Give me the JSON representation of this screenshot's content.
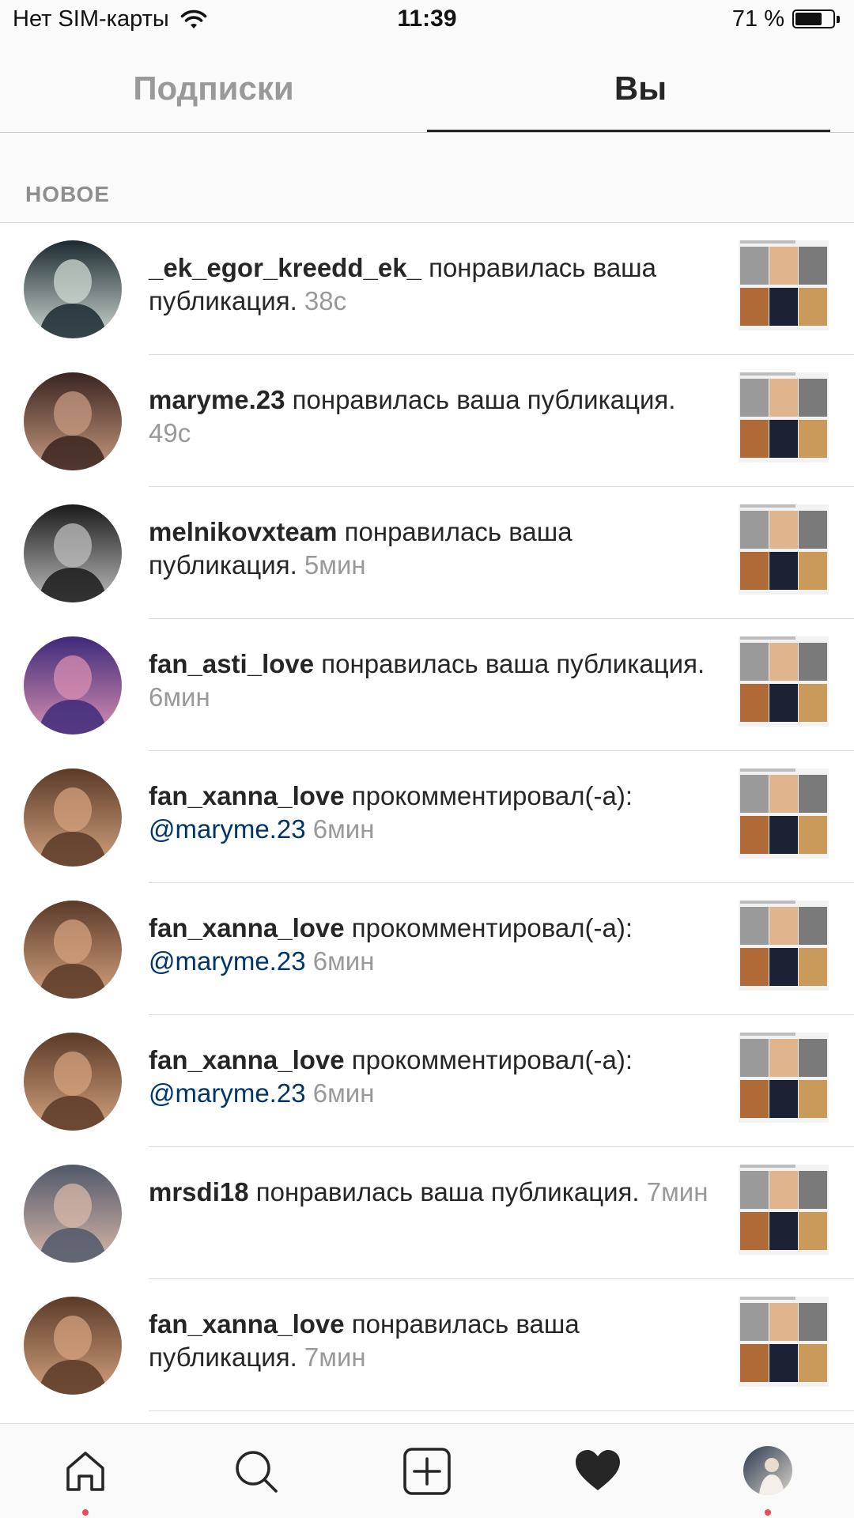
{
  "status_bar": {
    "carrier": "Нет SIM-карты",
    "time": "11:39",
    "battery_text": "71 %",
    "battery_level": 0.71
  },
  "tabs": {
    "following": "Подписки",
    "you": "Вы"
  },
  "section": {
    "label": "НОВОЕ"
  },
  "notifications": [
    {
      "username": "_ek_egor_kreedd_ek_",
      "action": " понравилась ваша публикация.",
      "mention": "",
      "time": " 38с",
      "avatar_colors": [
        "#1b2a30",
        "#cfd8d2"
      ]
    },
    {
      "username": "maryme.23",
      "action": " понравилась ваша публикация.",
      "mention": "",
      "time": " 49с",
      "avatar_colors": [
        "#3a2420",
        "#c79a80"
      ]
    },
    {
      "username": "melnikovxteam",
      "action": " понравилась ваша публикация.",
      "mention": "",
      "time": " 5мин",
      "avatar_colors": [
        "#1a1a1a",
        "#bdbdbd"
      ]
    },
    {
      "username": "fan_asti_love",
      "action": " понравилась ваша публикация.",
      "mention": "",
      "time": " 6мин",
      "avatar_colors": [
        "#3c2a7a",
        "#d98fb0"
      ]
    },
    {
      "username": "fan_xanna_love",
      "action": " прокомментировал(-а): ",
      "mention": "@maryme.23",
      "time": " 6мин",
      "avatar_colors": [
        "#5a3a28",
        "#d4a27e"
      ]
    },
    {
      "username": "fan_xanna_love",
      "action": " прокомментировал(-а): ",
      "mention": "@maryme.23",
      "time": " 6мин",
      "avatar_colors": [
        "#5a3a28",
        "#d4a27e"
      ]
    },
    {
      "username": "fan_xanna_love",
      "action": " прокомментировал(-а): ",
      "mention": "@maryme.23",
      "time": " 6мин",
      "avatar_colors": [
        "#5a3a28",
        "#d4a27e"
      ]
    },
    {
      "username": "mrsdi18",
      "action": " понравилась ваша публикация.",
      "mention": "",
      "time": " 7мин",
      "avatar_colors": [
        "#50586a",
        "#d8b8a8"
      ]
    },
    {
      "username": "fan_xanna_love",
      "action": " понравилась ваша публикация.",
      "mention": "",
      "time": " 7мин",
      "avatar_colors": [
        "#5a3a28",
        "#d4a27e"
      ]
    }
  ],
  "tab_bar": {
    "items": [
      {
        "icon": "home-icon",
        "has_dot": true
      },
      {
        "icon": "search-icon",
        "has_dot": false
      },
      {
        "icon": "add-post-icon",
        "has_dot": false
      },
      {
        "icon": "heart-icon",
        "has_dot": false
      },
      {
        "icon": "profile-avatar-icon",
        "has_dot": true
      }
    ]
  },
  "colors": {
    "text": "#262626",
    "muted": "#999999",
    "mention": "#003569",
    "badge_dot": "#ed4956",
    "divider": "#dbdbdb"
  }
}
